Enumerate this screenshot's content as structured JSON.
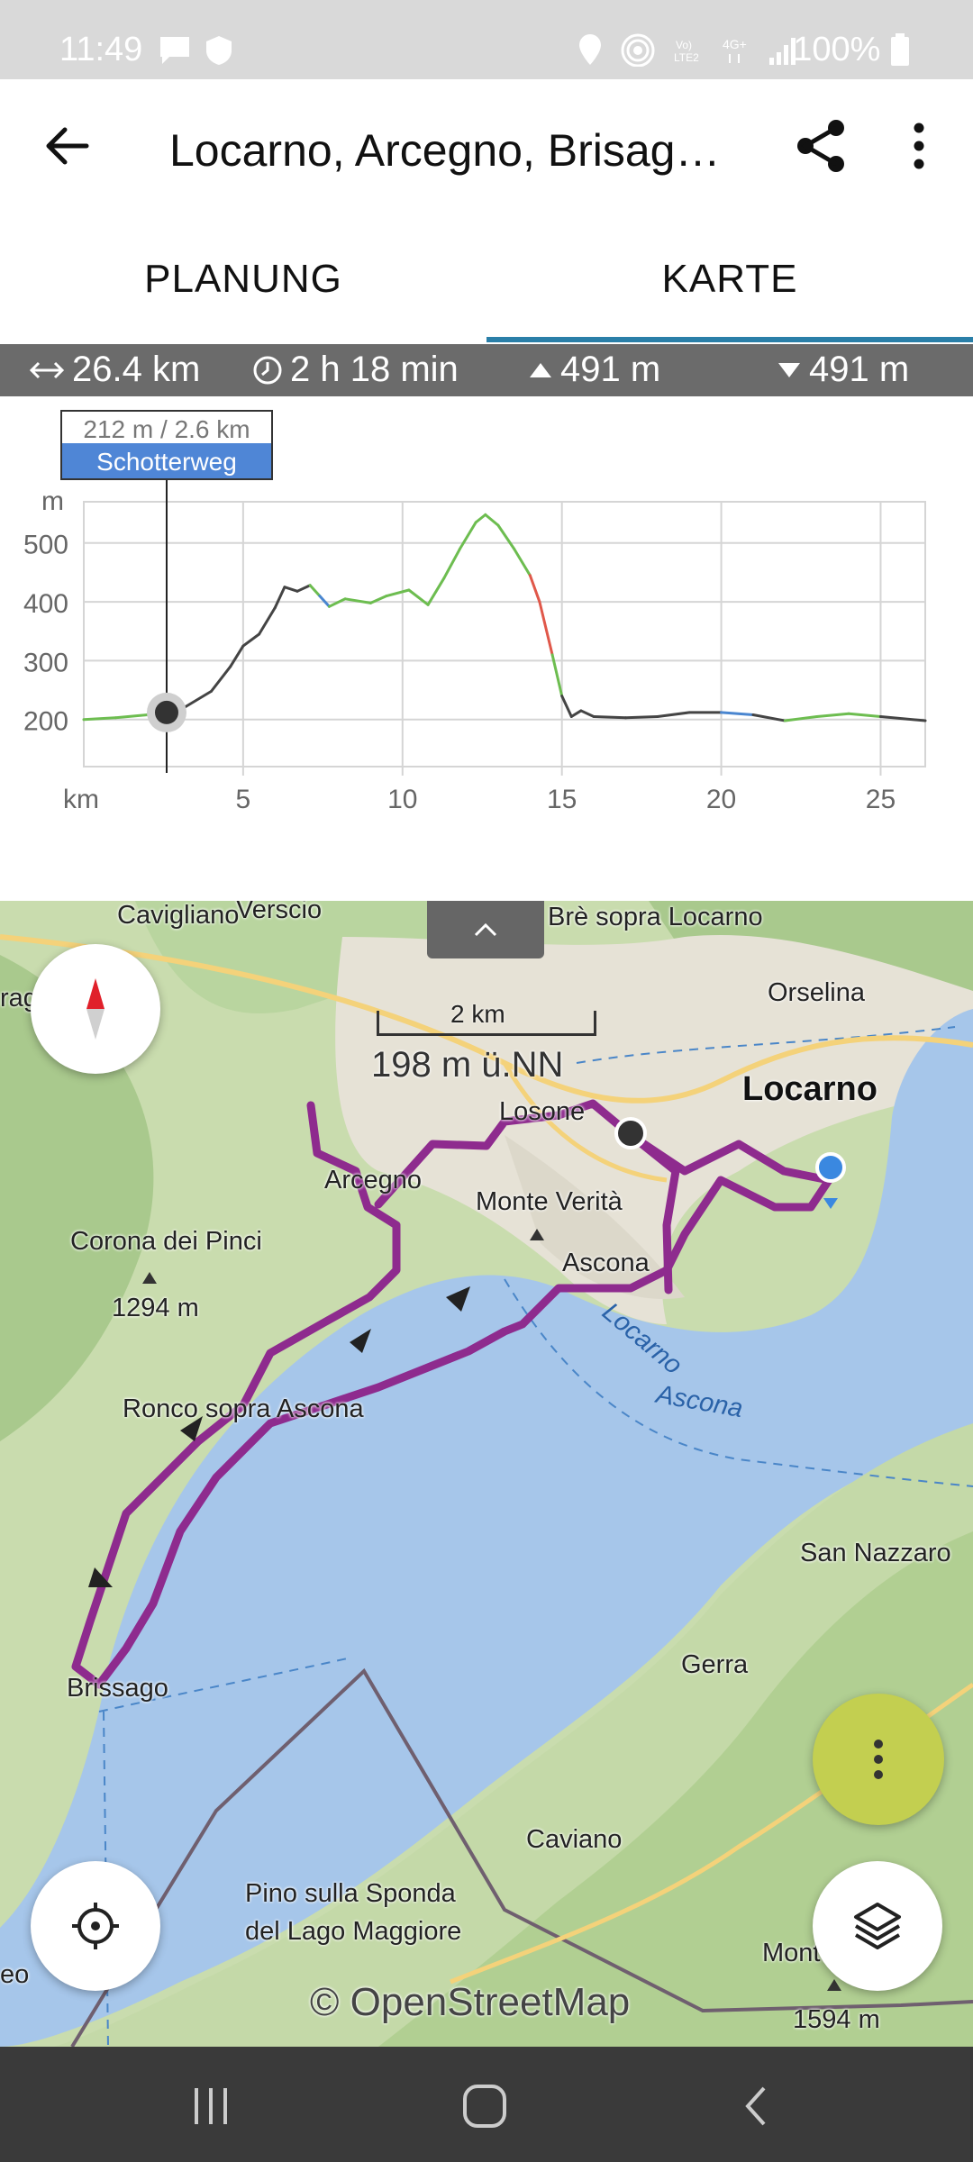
{
  "status_bar": {
    "time": "11:49",
    "battery": "100%"
  },
  "header": {
    "title": "Locarno, Arcegno, Brisag…"
  },
  "tabs": [
    {
      "label": "PLANUNG"
    },
    {
      "label": "KARTE"
    }
  ],
  "stats": {
    "distance": "26.4 km",
    "duration": "2 h 18 min",
    "ascent": "491 m",
    "descent": "491 m"
  },
  "elevation_tooltip": {
    "value": "212 m / 2.6 km",
    "surface": "Schotterweg"
  },
  "chart_data": {
    "type": "line",
    "ylabel": "m",
    "xlabel": "km",
    "x_ticks": [
      "5",
      "10",
      "15",
      "20",
      "25"
    ],
    "y_ticks": [
      "200",
      "300",
      "400",
      "500"
    ],
    "xlim": [
      0,
      26.4
    ],
    "ylim": [
      120,
      570
    ],
    "series": [
      {
        "x": [
          0,
          1,
          2,
          2.6,
          3.2,
          4,
          4.6,
          5,
          5.5,
          6,
          6.3,
          6.7,
          7.1,
          7.4,
          7.7,
          8.2,
          9,
          9.5,
          10.2,
          10.8,
          11.3,
          11.8,
          12.3,
          12.6,
          13,
          13.5,
          14,
          14.3,
          14.7,
          15,
          15.3,
          15.6,
          16,
          17,
          18,
          19,
          20,
          21,
          22,
          23,
          24,
          25,
          26.4
        ],
        "y": [
          200,
          203,
          208,
          212,
          222,
          248,
          290,
          325,
          345,
          390,
          425,
          418,
          428,
          410,
          392,
          405,
          398,
          410,
          420,
          395,
          440,
          490,
          535,
          548,
          530,
          490,
          445,
          400,
          310,
          240,
          205,
          215,
          205,
          203,
          205,
          212,
          212,
          208,
          198,
          205,
          210,
          205,
          198
        ]
      }
    ],
    "cursor_x": 2.6,
    "grid": true
  },
  "map": {
    "labels": [
      "Cavigliano",
      "Verscio",
      "Brè sopra Locarno",
      "Orselina",
      "Locarno",
      "Losone",
      "Arcegno",
      "Monte Verità",
      "Ascona",
      "Corona dei Pinci",
      "1294 m",
      "Ronco sopra Ascona",
      "Brissago",
      "San Nazzaro",
      "Gerra",
      "Caviano",
      "Pino sulla Sponda",
      "del Lago Maggiore",
      "Monte",
      "1594 m",
      "Locarno",
      "Ascona",
      "rag",
      "eo"
    ],
    "scale": "2 km",
    "elevation_readout": "198 m ü.NN",
    "attribution": "© OpenStreetMap",
    "colors": {
      "route": "#8e2b8e",
      "water": "#a8c7e8",
      "forest": "#b5d29b",
      "urban": "#e8e4dc"
    }
  },
  "icons": {
    "back": "arrow-left-icon",
    "share": "share-icon",
    "more": "more-vert-icon",
    "compass": "compass-icon",
    "locate": "gps-locate-icon",
    "layers": "layers-icon",
    "fab": "more-vert-icon"
  }
}
